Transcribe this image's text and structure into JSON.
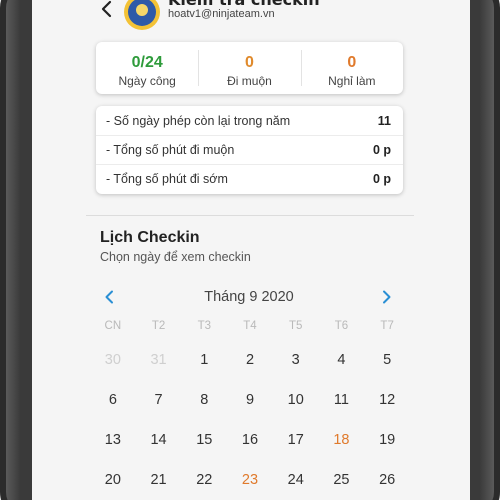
{
  "header": {
    "title": "Kiểm tra checkin",
    "email": "hoatv1@ninjateam.vn"
  },
  "stats": [
    {
      "value": "0/24",
      "label": "Ngày công",
      "color": "#2e9b3b"
    },
    {
      "value": "0",
      "label": "Đi muộn",
      "color": "#e08a2c"
    },
    {
      "value": "0",
      "label": "Nghỉ làm",
      "color": "#e07a2c"
    }
  ],
  "info": [
    {
      "label": "- Số ngày phép còn lại trong năm",
      "value": "11"
    },
    {
      "label": "- Tổng số phút đi muộn",
      "value": "0 p"
    },
    {
      "label": "- Tổng số phút đi sớm",
      "value": "0 p"
    }
  ],
  "calendar": {
    "title": "Lịch Checkin",
    "subtitle": "Chọn ngày để xem checkin",
    "month_label": "Tháng 9 2020",
    "accent_color": "#2a8fd4",
    "weekdays": [
      "CN",
      "T2",
      "T3",
      "T4",
      "T5",
      "T6",
      "T7"
    ],
    "weeks": [
      [
        {
          "d": "30",
          "s": "muted"
        },
        {
          "d": "31",
          "s": "muted"
        },
        {
          "d": "1"
        },
        {
          "d": "2"
        },
        {
          "d": "3"
        },
        {
          "d": "4"
        },
        {
          "d": "5"
        }
      ],
      [
        {
          "d": "6"
        },
        {
          "d": "7"
        },
        {
          "d": "8"
        },
        {
          "d": "9"
        },
        {
          "d": "10"
        },
        {
          "d": "11"
        },
        {
          "d": "12"
        }
      ],
      [
        {
          "d": "13"
        },
        {
          "d": "14"
        },
        {
          "d": "15"
        },
        {
          "d": "16"
        },
        {
          "d": "17"
        },
        {
          "d": "18",
          "s": "orange"
        },
        {
          "d": "19"
        }
      ],
      [
        {
          "d": "20"
        },
        {
          "d": "21"
        },
        {
          "d": "22"
        },
        {
          "d": "23",
          "s": "orange"
        },
        {
          "d": "24"
        },
        {
          "d": "25"
        },
        {
          "d": "26"
        }
      ]
    ]
  },
  "icons": {
    "back": "chevron-left-icon",
    "prev": "chevron-left-icon",
    "next": "chevron-right-icon",
    "avatar": "ninja-avatar"
  }
}
